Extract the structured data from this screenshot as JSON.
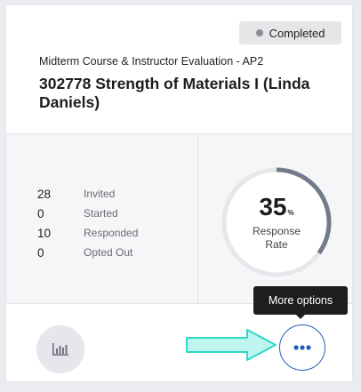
{
  "card": {
    "status": "Completed",
    "evaluation_name": "Midterm Course & Instructor Evaluation - AP2",
    "course_title": "302778 Strength of Materials I (Linda Daniels)"
  },
  "stats": [
    {
      "value": "28",
      "label": "Invited"
    },
    {
      "value": "0",
      "label": "Started"
    },
    {
      "value": "10",
      "label": "Responded"
    },
    {
      "value": "0",
      "label": "Opted Out"
    }
  ],
  "response_rate": {
    "value": "35",
    "unit": "%",
    "label_line1": "Response",
    "label_line2": "Rate",
    "fraction": 0.35
  },
  "tooltip": {
    "text": "More options"
  },
  "icons": {
    "status": "status-dot-icon",
    "report": "bar-chart-icon",
    "more": "ellipsis-icon",
    "annotation": "arrow-right-icon"
  },
  "colors": {
    "gauge_track": "#e6e7ea",
    "gauge_fill": "#737b8a",
    "more_button_accent": "#1f5fb8",
    "annotation_arrow": "#2ed8c8"
  }
}
